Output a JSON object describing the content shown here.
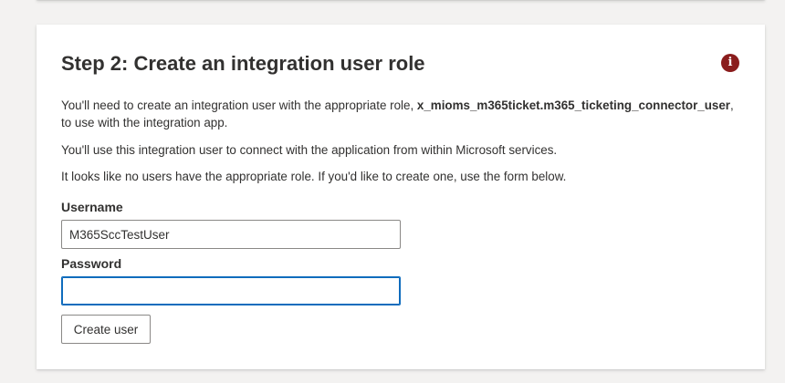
{
  "step": {
    "title": "Step 2: Create an integration user role",
    "info_icon": "i",
    "paragraph1_before": "You'll need to create an integration user with the appropriate role, ",
    "role_name": "x_mioms_m365ticket.m365_ticketing_connector_user",
    "paragraph1_after": ", to use with the integration app.",
    "paragraph2": "You'll use this integration user to connect with the application from within Microsoft services.",
    "paragraph3": "It looks like no users have the appropriate role. If you'd like to create one, use the form below."
  },
  "form": {
    "username_label": "Username",
    "username_value": "M365SccTestUser",
    "password_label": "Password",
    "password_value": "",
    "create_button_label": "Create user"
  },
  "icons": {
    "info": "info-icon"
  },
  "colors": {
    "info_icon_bg": "#8a1c1c",
    "focus_border": "#0f6cbd",
    "page_background": "#f3f2f1"
  }
}
